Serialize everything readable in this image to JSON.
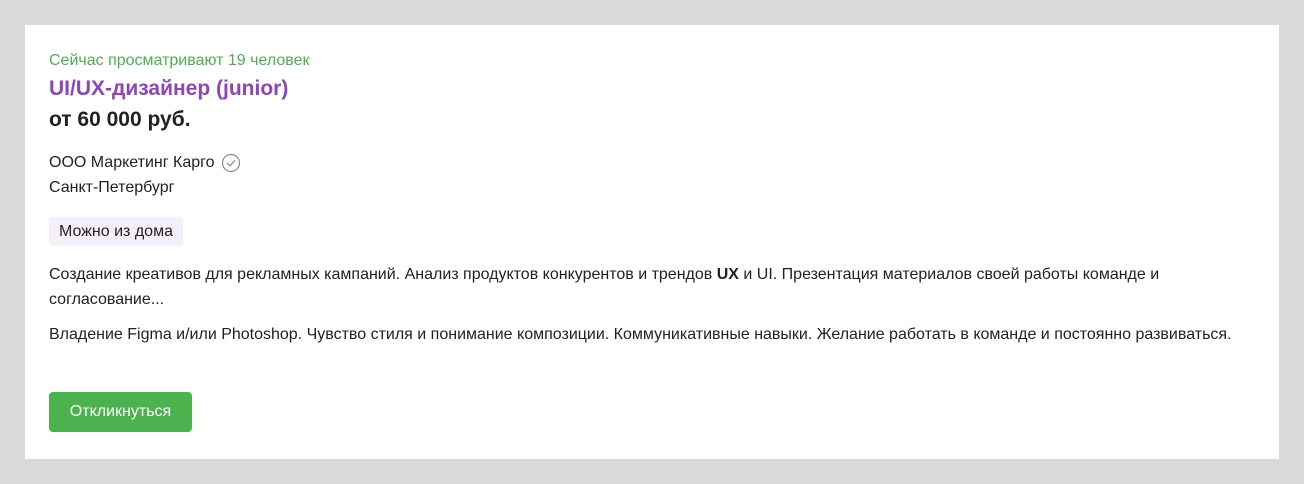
{
  "vacancy": {
    "viewers_text": "Сейчас просматривают 19 человек",
    "title": "UI/UX-дизайнер (junior)",
    "salary": "от 60 000 руб.",
    "company": "ООО Маркетинг Карго",
    "company_verified_icon": "check-circle-icon",
    "city": "Санкт-Петербург",
    "tag": "Можно из дома",
    "description": {
      "part1": "Создание креативов для рекламных кампаний. Анализ продуктов конкурентов и трендов ",
      "highlight": "UX",
      "part2": " и UI. Презентация материалов своей работы команде и согласование..."
    },
    "requirements": "Владение Figma и/или Photoshop. Чувство стиля и понимание композиции. Коммуникативные навыки. Желание работать в команде и постоянно развиваться.",
    "apply_label": "Откликнуться"
  },
  "colors": {
    "page_background": "#d9d9d9",
    "card_background": "#ffffff",
    "accent_green": "#4bb24e",
    "title_purple": "#8e45b8",
    "tag_background": "#f4eff9",
    "text": "#222222"
  }
}
